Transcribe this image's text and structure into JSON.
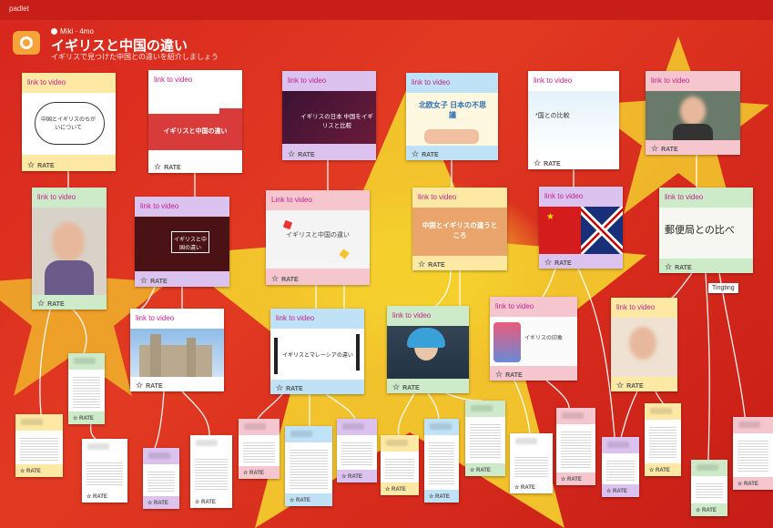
{
  "brand": "padlet",
  "header": {
    "author": "Miki",
    "age": "4mo",
    "title": "イギリスと中国の違い",
    "subtitle": "イギリスで見つけた中国との違いを紹介しましょう"
  },
  "link_label": "link to video",
  "link_label_alt": "Link to video",
  "rate_label": "RATE",
  "tooltip": "Tingting",
  "cards": {
    "c1": {
      "thumb_text": "中国とイギリスのちがいについて"
    },
    "c2": {
      "thumb_text": "イギリスと中国の違い"
    },
    "c3": {
      "thumb_text": "イギリスの日本 中国をイギリスと比較"
    },
    "c4": {
      "thumb_text": "北欧女子 日本の不思議"
    },
    "c5": {
      "thumb_text": "*国との比較"
    },
    "c8": {
      "thumb_text": "イギリスと中国の違い"
    },
    "c9": {
      "thumb_text": "中国とイギリスの違うところ"
    },
    "c11": {
      "thumb_text": "郵便局との比べ"
    },
    "c14": {
      "thumb_text": "イギリスとマレーシアの違い"
    },
    "c16": {
      "thumb_text": "イギリスの印象"
    }
  },
  "colors": {
    "background": "#d7261e",
    "star": "#f6d630",
    "accent": "#c0238f"
  }
}
